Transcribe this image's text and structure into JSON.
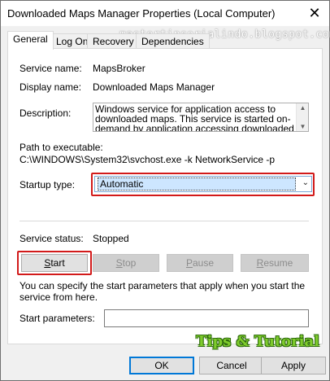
{
  "window": {
    "title": "Downloaded Maps Manager Properties (Local Computer)",
    "close_label": "✕"
  },
  "watermark_text": "mastertipsorialindo.blogspot.com",
  "tabs": [
    {
      "label": "General",
      "active": true
    },
    {
      "label": "Log On",
      "active": false
    },
    {
      "label": "Recovery",
      "active": false
    },
    {
      "label": "Dependencies",
      "active": false
    }
  ],
  "general": {
    "service_name_label": "Service name:",
    "service_name_value": "MapsBroker",
    "display_name_label": "Display name:",
    "display_name_value": "Downloaded Maps Manager",
    "description_label": "Description:",
    "description_value": "Windows service for application access to downloaded maps. This service is started on-demand by application accessing downloaded",
    "path_label": "Path to executable:",
    "path_value": "C:\\WINDOWS\\System32\\svchost.exe -k NetworkService -p",
    "startup_type_label": "Startup type:",
    "startup_type_value": "Automatic",
    "service_status_label": "Service status:",
    "service_status_value": "Stopped",
    "buttons": {
      "start": "Start",
      "stop": "Stop",
      "pause": "Pause",
      "resume": "Resume"
    },
    "start_params_hint": "You can specify the start parameters that apply when you start the service from here.",
    "start_params_label": "Start parameters:",
    "start_params_value": ""
  },
  "footer": {
    "ok": "OK",
    "cancel": "Cancel",
    "apply": "Apply"
  },
  "brand_text": "Tips & Tutorial",
  "colors": {
    "highlight_outline": "#d21a1a",
    "selection_bg": "#cde6ff",
    "accent": "#0078d7"
  }
}
